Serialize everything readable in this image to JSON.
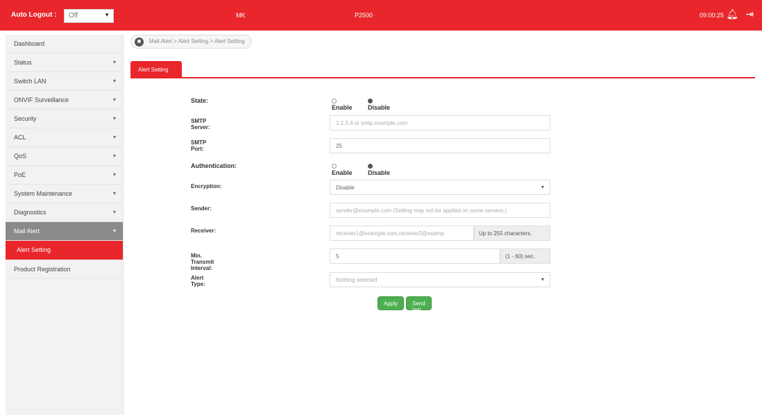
{
  "header": {
    "auto_logout_label": "Auto Logout :",
    "auto_logout_value": "Off",
    "model_left": "MK",
    "model_right": "P2500",
    "clock": "09:00:25"
  },
  "sidebar": {
    "items": [
      {
        "label": "Dashboard"
      },
      {
        "label": "Status"
      },
      {
        "label": "Switch LAN"
      },
      {
        "label": "ONVIF Surveillance"
      },
      {
        "label": "Security"
      },
      {
        "label": "ACL"
      },
      {
        "label": "QoS"
      },
      {
        "label": "PoE"
      },
      {
        "label": "System Maintenance"
      },
      {
        "label": "Diagnostics"
      },
      {
        "label": "Mail Alert"
      },
      {
        "label": "Alert Setting"
      },
      {
        "label": "Product Registration"
      }
    ]
  },
  "breadcrumb": "Mail Alert > Alert Setting > Alert Setting",
  "tab": "Alert Setting",
  "form": {
    "state_label": "State:",
    "enable": "Enable",
    "disable": "Disable",
    "smtp_server_label": "SMTP Server:",
    "smtp_server_placeholder": "1.2.3.4 or smtp.example.com",
    "smtp_port_label": "SMTP Port:",
    "smtp_port_value": "25",
    "auth_label": "Authentication:",
    "encryption_label": "Encryption:",
    "encryption_value": "Disable",
    "sender_label": "Sender:",
    "sender_placeholder": "sender@example.com (Setting may not be applied on some servers.)",
    "receiver_label": "Receiver:",
    "receiver_placeholder": "receiver1@example.com,receiver2@examp",
    "receiver_addon": "Up to 255 characters.",
    "interval_label": "Min. Transmit Interval:",
    "interval_value": "5",
    "interval_addon": "(1 - 60) sec.",
    "alert_type_label": "Alert Type:",
    "alert_type_value": "Nothing selected",
    "apply": "Apply",
    "send_test": "Send test mail"
  }
}
